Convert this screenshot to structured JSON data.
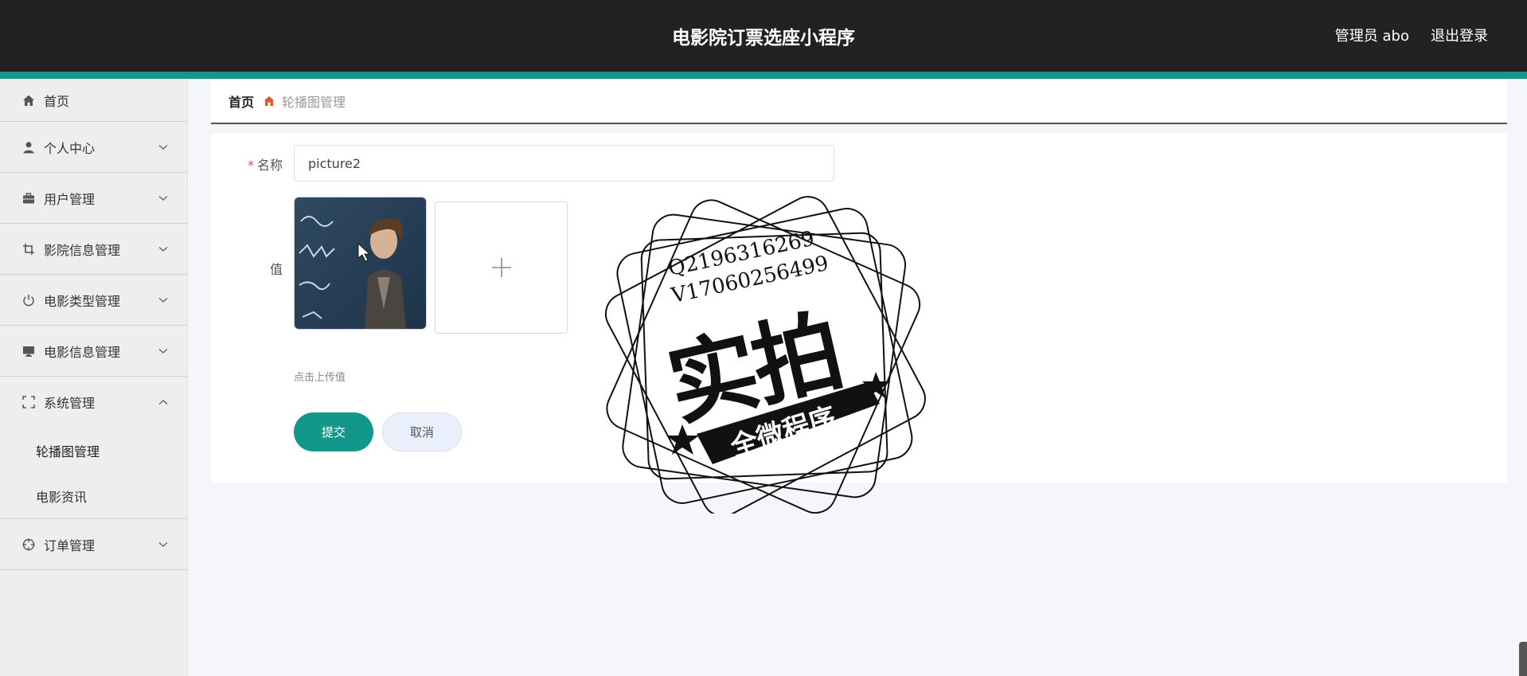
{
  "header": {
    "app_title": "电影院订票选座小程序",
    "admin_label": "管理员 abo",
    "logout_label": "退出登录"
  },
  "sidebar": {
    "items": [
      {
        "label": "首页",
        "icon": "home-icon"
      },
      {
        "label": "个人中心",
        "icon": "user-icon"
      },
      {
        "label": "用户管理",
        "icon": "briefcase-icon"
      },
      {
        "label": "影院信息管理",
        "icon": "crop-icon"
      },
      {
        "label": "电影类型管理",
        "icon": "power-icon"
      },
      {
        "label": "电影信息管理",
        "icon": "monitor-icon"
      },
      {
        "label": "系统管理",
        "icon": "fullscreen-icon"
      },
      {
        "label": "订单管理",
        "icon": "target-icon"
      }
    ],
    "system_submenu": [
      "轮播图管理",
      "电影资讯"
    ]
  },
  "breadcrumb": {
    "home": "首页",
    "current": "轮播图管理"
  },
  "form": {
    "name_label": "名称",
    "name_value": "picture2",
    "value_label": "值",
    "upload_hint": "点击上传值",
    "submit_label": "提交",
    "cancel_label": "取消"
  },
  "watermark": {
    "line1": "Q2196316269",
    "line2": "V17060256499",
    "big_text": "实拍",
    "banner_text": "全微程序"
  },
  "colors": {
    "header_bg": "#222222",
    "accent": "#15968a",
    "submit": "#12988b",
    "required": "#e04848"
  }
}
